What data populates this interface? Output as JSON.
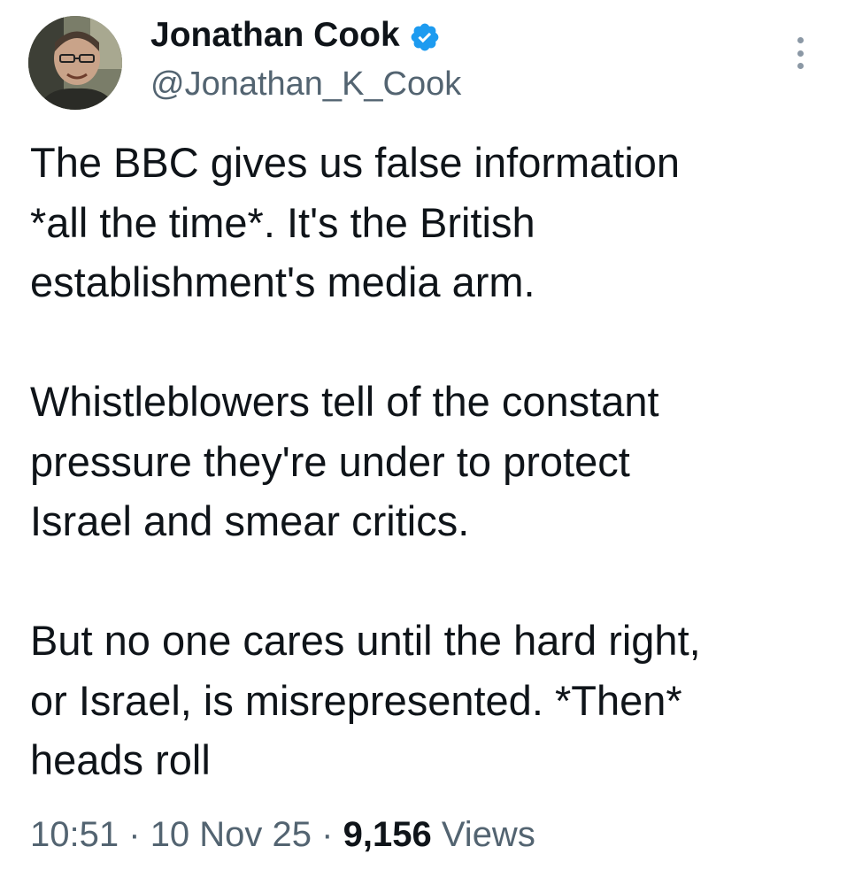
{
  "author": {
    "name": "Jonathan Cook",
    "handle": "@Jonathan_K_Cook",
    "verified": true,
    "verified_color": "#1d9bf0"
  },
  "icons": {
    "verified": "verified-badge-icon",
    "more": "more-options-icon"
  },
  "tweet": {
    "paragraphs": [
      "The BBC gives us false information\n*all the time*. It's the British\nestablishment's media arm.",
      "Whistleblowers tell of the constant\npressure they're under to protect\nIsrael and smear critics.",
      "But no one cares until the hard right,\nor Israel, is misrepresented. *Then*\nheads roll"
    ]
  },
  "meta": {
    "time": "10:51",
    "separator": "·",
    "date": "10 Nov 25",
    "views_count": "9,156",
    "views_label": "Views"
  },
  "colors": {
    "text": "#0f1419",
    "secondary": "#536471",
    "background": "#ffffff"
  }
}
